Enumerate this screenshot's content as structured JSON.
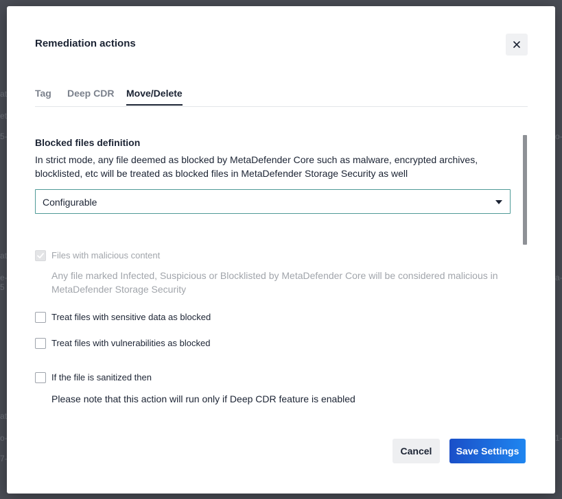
{
  "modal": {
    "title": "Remediation actions",
    "close_label": "×"
  },
  "tabs": [
    {
      "label": "Tag",
      "active": false
    },
    {
      "label": "Deep CDR",
      "active": false
    },
    {
      "label": "Move/Delete",
      "active": true
    }
  ],
  "blocked_files": {
    "heading": "Blocked files definition",
    "description": "In strict mode, any file deemed as blocked by MetaDefender Core such as malware, encrypted archives, blocklisted, etc will be treated as blocked files in MetaDefender Storage Security as well",
    "select_value": "Configurable"
  },
  "options": [
    {
      "label": "Files with malicious content",
      "checked": true,
      "disabled": true,
      "note": "Any file marked Infected, Suspicious or Blocklisted by MetaDefender Core will be considered malicious in MetaDefender Storage Security"
    },
    {
      "label": "Treat files with sensitive data as blocked",
      "checked": false,
      "disabled": false
    },
    {
      "label": "Treat files with vulnerabilities as blocked",
      "checked": false,
      "disabled": false
    },
    {
      "label": "If the file is sanitized then",
      "checked": false,
      "disabled": false,
      "note": "Please note that this action will run only if Deep CDR feature is enabled"
    }
  ],
  "footer": {
    "cancel_label": "Cancel",
    "save_label": "Save Settings"
  },
  "colors": {
    "primary_start": "#1a4fc8",
    "primary_end": "#1f86f0",
    "select_border": "#4e9a97"
  }
}
